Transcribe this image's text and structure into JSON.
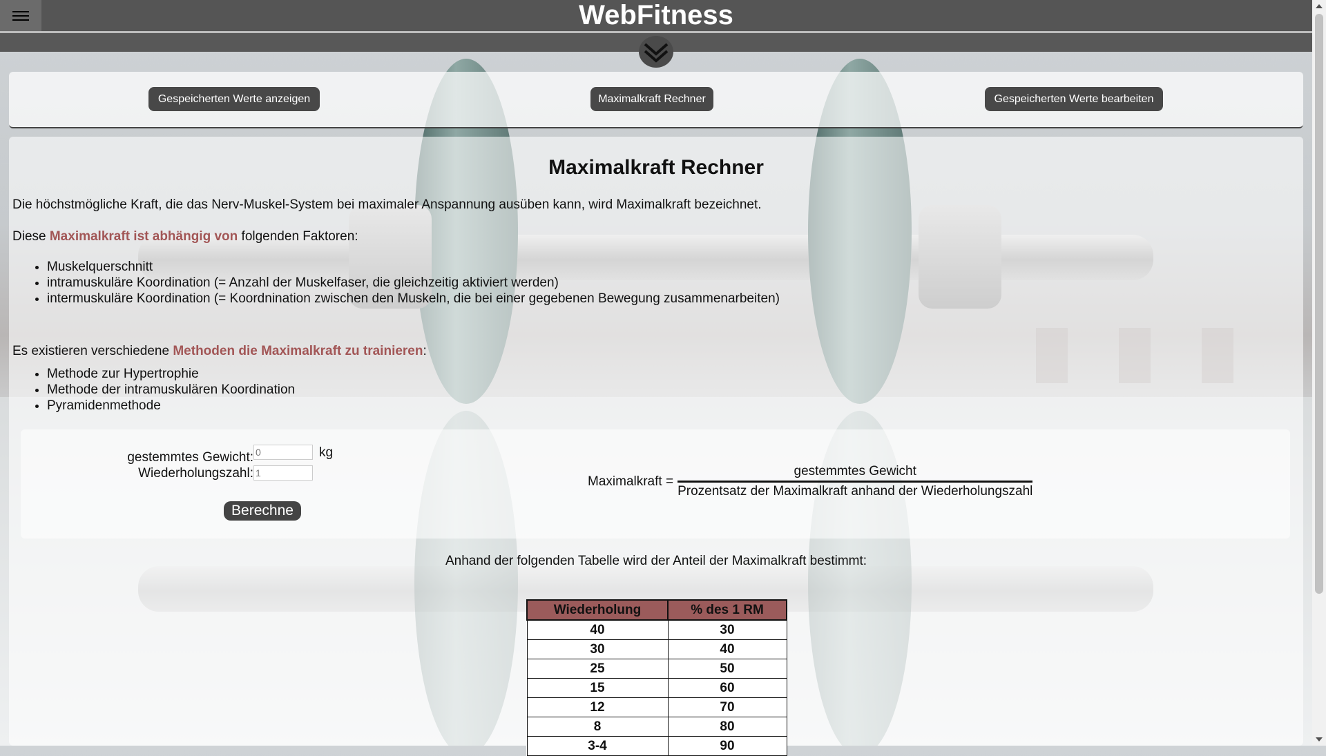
{
  "header": {
    "brand": "WebFitness",
    "menu_icon": "hamburger-icon",
    "expand_icon": "double-chevron-down-icon"
  },
  "nav": {
    "show_saved": "Gespeicherten Werte anzeigen",
    "calculator": "Maximalkraft Rechner",
    "edit_saved": "Gespeicherten Werte bearbeiten"
  },
  "content": {
    "title": "Maximalkraft Rechner",
    "intro": "Die höchstmögliche Kraft, die das Nerv-Muskel-System bei maximaler Anspannung ausüben kann, wird Maximalkraft bezeichnet.",
    "factors_prefix": "Diese ",
    "factors_highlight": "Maximalkraft ist abhängig von",
    "factors_suffix": " folgenden Faktoren:",
    "factors": [
      "Muskelquerschnitt",
      "intramuskuläre Koordination (= Anzahl der Muskelfaser, die gleichzeitig aktiviert werden)",
      "intermuskuläre Koordination (= Koordnination zwischen den Muskeln, die bei einer gegebenen Bewegung zusammenarbeiten)"
    ],
    "methods_prefix": "Es existieren verschiedene ",
    "methods_highlight": "Methoden die Maximalkraft zu trainieren",
    "methods_suffix": ":",
    "methods": [
      "Methode zur Hypertrophie",
      "Methode der intramuskulären Koordination",
      "Pyramidenmethode"
    ]
  },
  "calculator": {
    "weight_label": "gestemmtes Gewicht:",
    "weight_placeholder": "0",
    "weight_unit": "kg",
    "reps_label": "Wiederholungszahl:",
    "reps_placeholder": "1",
    "button": "Berechne",
    "formula_lhs": "Maximalkraft =",
    "formula_numerator": "gestemmtes Gewicht",
    "formula_denominator": "Prozentsatz der Maximalkraft anhand der Wiederholungszahl"
  },
  "table": {
    "caption": "Anhand der folgenden Tabelle wird der Anteil der Maximalkraft bestimmt:",
    "headers": [
      "Wiederholung",
      "% des 1 RM"
    ],
    "rows": [
      [
        "40",
        "30"
      ],
      [
        "30",
        "40"
      ],
      [
        "25",
        "50"
      ],
      [
        "15",
        "60"
      ],
      [
        "12",
        "70"
      ],
      [
        "8",
        "80"
      ],
      [
        "3-4",
        "90"
      ]
    ]
  },
  "colors": {
    "accent": "#a25656",
    "table_header": "#9b5b5b",
    "topbar": "#555555"
  }
}
